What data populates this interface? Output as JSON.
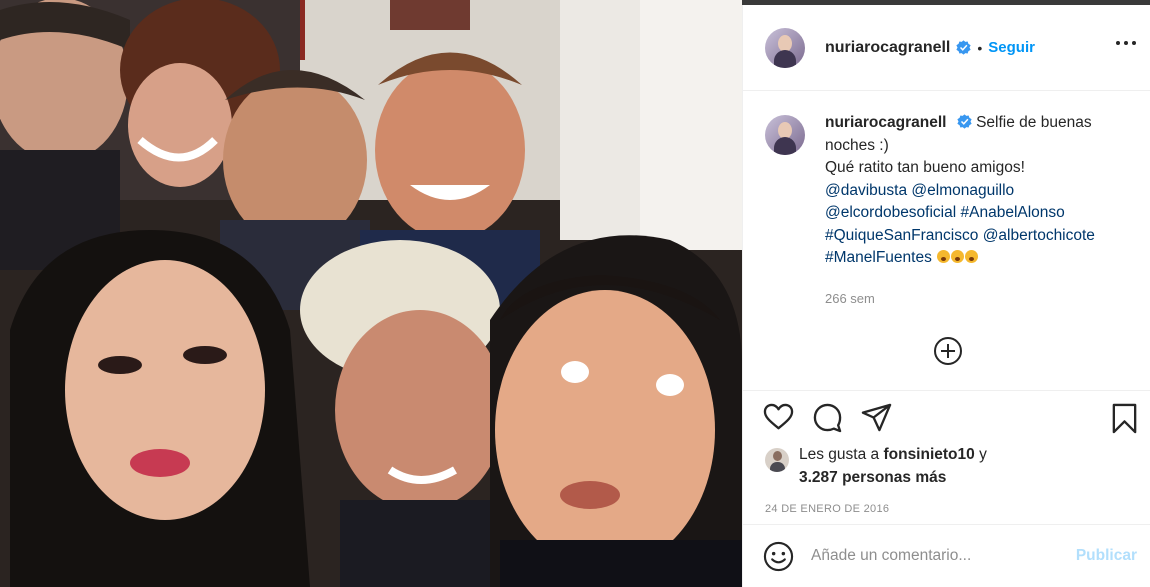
{
  "post": {
    "author": "nuriarocagranell",
    "follow_label": "Seguir",
    "separator": "•",
    "caption": {
      "line1": "Selfie de buenas noches :)",
      "line2": "Qué ratito tan bueno amigos!",
      "tag1": "@davibusta",
      "tag2": "@elmonaguillo",
      "tag3": "@elcordobesoficial",
      "tag4": "#AnabelAlonso",
      "tag5": "#QuiqueSanFrancisco",
      "tag6": "@albertochicote",
      "tag7": "#ManelFuentes"
    },
    "caption_time": "266 sem",
    "likes": {
      "prefix": "Les gusta a",
      "user": "fonsinieto10",
      "joiner": "y",
      "others": "3.287 personas más"
    },
    "date": "24 DE ENERO DE 2016"
  },
  "comment": {
    "placeholder": "Añade un comentario...",
    "publish_label": "Publicar"
  },
  "icons": {
    "verified": "verified-badge-icon",
    "more": "more-options-icon",
    "like": "heart-icon",
    "comment": "comment-icon",
    "share": "share-icon",
    "save": "bookmark-icon",
    "load_more": "plus-circle-icon",
    "emoji": "smiley-icon"
  },
  "colors": {
    "link": "#00376b",
    "follow": "#0095f6",
    "publish_disabled": "#b2dffc",
    "muted": "#8e8e8e"
  }
}
